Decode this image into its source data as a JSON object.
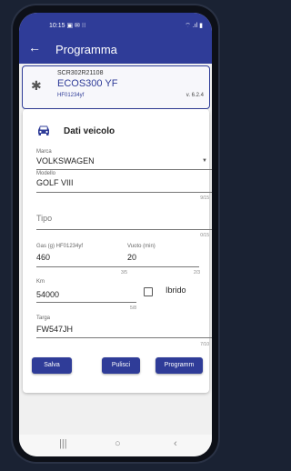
{
  "status": {
    "time": "10:15",
    "left_icons": "▣ ✉ ⁝⁝",
    "right_icons": "⌔ .ıl ▮"
  },
  "appbar": {
    "title": "Programma"
  },
  "device": {
    "serial": "SCR302R21108",
    "name": "ECOS300 YF",
    "code": "HF01234yf",
    "version": "v. 6.2.4"
  },
  "vehicle": {
    "title": "Dati veicolo",
    "make": {
      "label": "Marca",
      "value": "VOLKSWAGEN"
    },
    "model": {
      "label": "Modello",
      "value": "GOLF VIII",
      "counter": "9/15"
    },
    "type": {
      "placeholder": "Tipo",
      "counter": "0/15"
    },
    "gas": {
      "label": "Gas (g) HF01234yf",
      "value": "460",
      "counter": "3/5"
    },
    "vacuum": {
      "label": "Vuoto (min)",
      "value": "20",
      "counter": "2/3"
    },
    "km": {
      "label": "Km",
      "value": "54000",
      "counter": "5/8"
    },
    "hybrid": {
      "label": "Ibrido"
    },
    "plate": {
      "label": "Targa",
      "value": "FW547JH",
      "counter": "7/10"
    }
  },
  "buttons": {
    "save": "Salva",
    "clear": "Pulisci",
    "program": "Programm"
  },
  "navbar": {
    "recent": "|||",
    "home": "○",
    "back": "‹"
  }
}
